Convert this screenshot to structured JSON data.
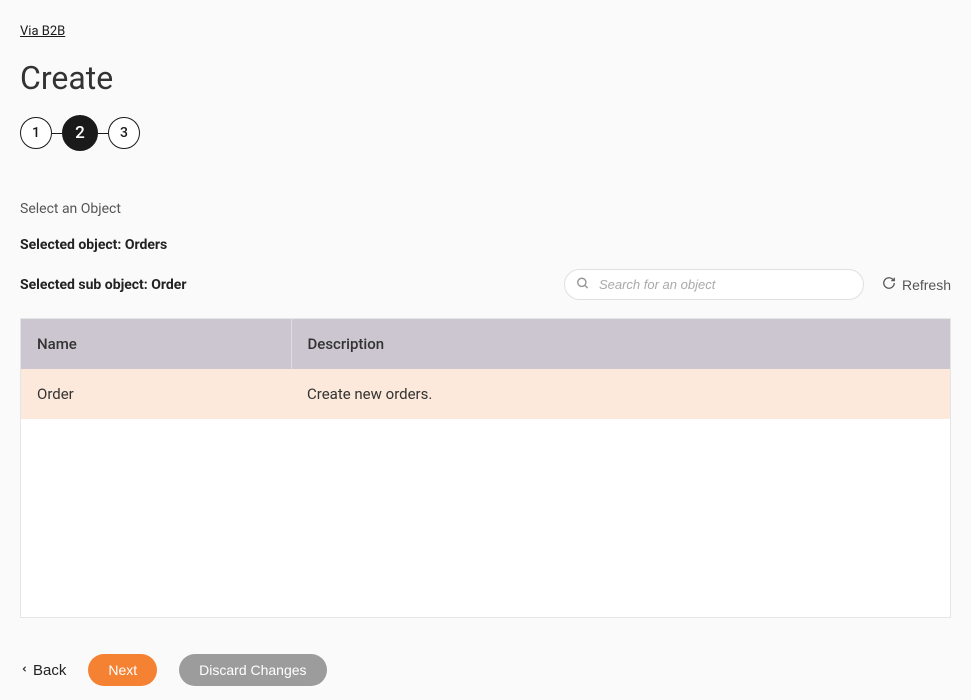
{
  "breadcrumb": "Via B2B",
  "page_title": "Create",
  "stepper": {
    "steps": [
      "1",
      "2",
      "3"
    ],
    "active_index": 1
  },
  "section_label": "Select an Object",
  "selected_object_line": "Selected object: Orders",
  "selected_sub_object_line": "Selected sub object: Order",
  "search": {
    "placeholder": "Search for an object"
  },
  "refresh_label": "Refresh",
  "table": {
    "columns": [
      "Name",
      "Description"
    ],
    "rows": [
      {
        "name": "Order",
        "description": "Create new orders.",
        "selected": true
      }
    ]
  },
  "footer": {
    "back_label": "Back",
    "next_label": "Next",
    "discard_label": "Discard Changes"
  }
}
